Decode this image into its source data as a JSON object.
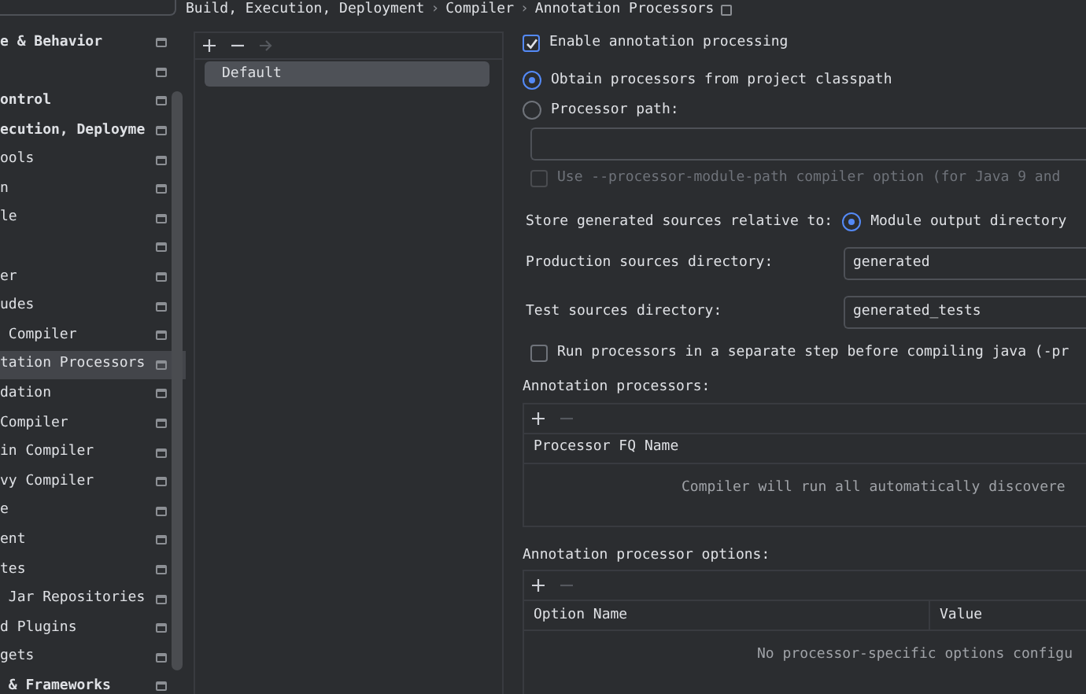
{
  "breadcrumb": {
    "path": [
      {
        "kind": "item",
        "text": "Build, Execution, Deployment"
      },
      {
        "kind": "separator",
        "text": "›"
      },
      {
        "kind": "item",
        "text": "Compiler"
      },
      {
        "kind": "separator",
        "text": "›"
      },
      {
        "kind": "item",
        "text": "Annotation Processors"
      }
    ]
  },
  "sidebar": {
    "items": [
      {
        "label": "e & Behavior",
        "bold": true,
        "selected": false
      },
      {
        "selected": false
      },
      {
        "label": "ontrol",
        "bold": true,
        "selected": false
      },
      {
        "label": "ecution, Deployme",
        "bold": true,
        "selected": false
      },
      {
        "label": "ools",
        "bold": false,
        "selected": false
      },
      {
        "label": "n",
        "bold": false,
        "selected": false
      },
      {
        "label": "le",
        "bold": false,
        "selected": false
      },
      {
        "selected": false
      },
      {
        "label": "er",
        "bold": false,
        "selected": false
      },
      {
        "label": "udes",
        "bold": false,
        "selected": false
      },
      {
        "label": " Compiler",
        "bold": false,
        "selected": false
      },
      {
        "label": "tation Processors",
        "bold": false,
        "selected": true
      },
      {
        "label": "dation",
        "bold": false,
        "selected": false
      },
      {
        "label": "Compiler",
        "bold": false,
        "selected": false
      },
      {
        "label": "in Compiler",
        "bold": false,
        "selected": false
      },
      {
        "label": "vy Compiler",
        "bold": false,
        "selected": false
      },
      {
        "label": "e",
        "bold": false,
        "selected": false
      },
      {
        "label": "ent",
        "bold": false,
        "selected": false
      },
      {
        "label": "tes",
        "bold": false,
        "selected": false
      },
      {
        "label": " Jar Repositories",
        "bold": false,
        "selected": false
      },
      {
        "label": "d Plugins",
        "bold": false,
        "selected": false
      },
      {
        "label": "gets",
        "bold": false,
        "selected": false
      },
      {
        "label": " & Frameworks",
        "bold": true,
        "selected": false
      }
    ]
  },
  "profiles": {
    "toolbar": [
      {
        "kind": "add",
        "disabled": false
      },
      {
        "kind": "remove",
        "disabled": false
      },
      {
        "kind": "arrow",
        "disabled": true
      }
    ],
    "items": [
      {
        "label": "Default",
        "selected": true
      }
    ]
  },
  "settings": {
    "enable": {
      "label": "Enable annotation processing",
      "checked": true,
      "disabled": false
    },
    "source_options": [
      {
        "label": "Obtain processors from project classpath",
        "selected": true
      },
      {
        "label": "Processor path:",
        "selected": false
      }
    ],
    "module_path_option": {
      "label": "Use --processor-module-path compiler option (for Java 9 and",
      "checked": false,
      "disabled": true
    },
    "store_relative": {
      "label": "Store generated sources relative to:",
      "options": [
        {
          "label": "Module output directory",
          "selected": true
        }
      ]
    },
    "directories": [
      {
        "label": "Production sources directory:",
        "value": "generated"
      },
      {
        "label": "Test sources directory:",
        "value": "generated_tests"
      }
    ],
    "separate_step": {
      "label": "Run processors in a separate step before compiling java (-pr",
      "checked": false,
      "disabled": false
    }
  },
  "tables": [
    {
      "title": "Annotation processors:",
      "toolbar": [
        {
          "kind": "add",
          "disabled": false
        },
        {
          "kind": "remove",
          "disabled": true
        }
      ],
      "columns": [
        "Processor FQ Name"
      ],
      "empty_text": "Compiler will run all automatically discovere"
    },
    {
      "title": "Annotation processor options:",
      "toolbar": [
        {
          "kind": "add",
          "disabled": false
        },
        {
          "kind": "remove",
          "disabled": true
        }
      ],
      "columns": [
        "Option Name",
        "Value"
      ],
      "empty_text": "No processor-specific options configu"
    }
  ]
}
